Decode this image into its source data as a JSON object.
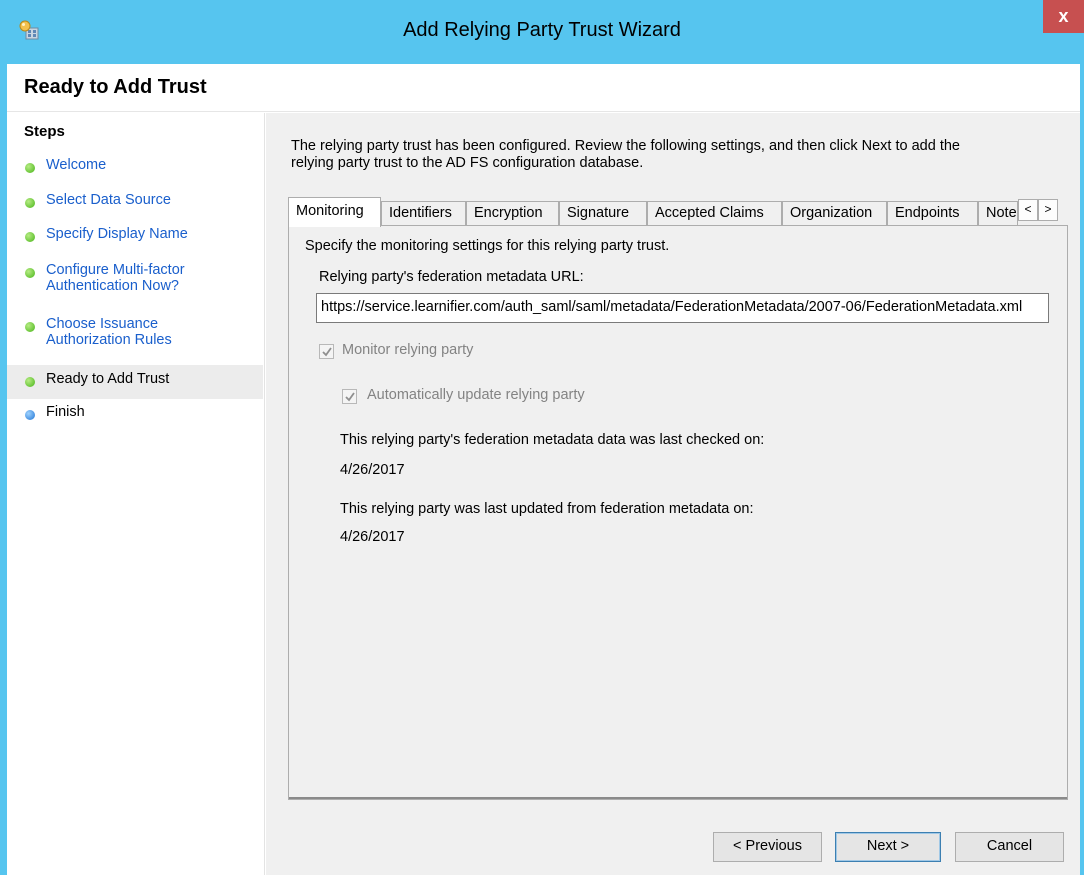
{
  "window": {
    "title": "Add Relying Party Trust Wizard",
    "close_glyph": "x"
  },
  "header": {
    "page_title": "Ready to Add Trust"
  },
  "steps": {
    "heading": "Steps",
    "items": [
      {
        "line1": "Welcome",
        "line2": "",
        "state": "done"
      },
      {
        "line1": "Select Data Source",
        "line2": "",
        "state": "done"
      },
      {
        "line1": "Specify Display Name",
        "line2": "",
        "state": "done"
      },
      {
        "line1": "Configure Multi-factor",
        "line2": "Authentication Now?",
        "state": "done"
      },
      {
        "line1": "Choose Issuance",
        "line2": "Authorization Rules",
        "state": "done"
      },
      {
        "line1": "Ready to Add Trust",
        "line2": "",
        "state": "current"
      },
      {
        "line1": "Finish",
        "line2": "",
        "state": "pending"
      }
    ]
  },
  "intro": {
    "line1": "The relying party trust has been configured. Review the following settings, and then click Next to add the",
    "line2": "relying party trust to the AD FS configuration database."
  },
  "tabs": {
    "items": [
      "Monitoring",
      "Identifiers",
      "Encryption",
      "Signature",
      "Accepted Claims",
      "Organization",
      "Endpoints",
      "Note"
    ],
    "selected": "Monitoring",
    "scroll_left": "<",
    "scroll_right": ">"
  },
  "monitoring": {
    "description": "Specify the monitoring settings for this relying party trust.",
    "url_label": "Relying party's federation metadata URL:",
    "url_value": "https://service.learnifier.com/auth_saml/saml/metadata/FederationMetadata/2007-06/FederationMetadata.xml",
    "monitor_label": "Monitor relying party",
    "monitor_checked": true,
    "auto_update_label": "Automatically update relying party",
    "auto_update_checked": true,
    "last_checked_label": "This relying party's federation metadata data was last checked on:",
    "last_checked_value": "4/26/2017",
    "last_updated_label": "This relying party was last updated from federation metadata on:",
    "last_updated_value": "4/26/2017"
  },
  "buttons": {
    "previous": "< Previous",
    "next": "Next >",
    "cancel": "Cancel"
  },
  "colors": {
    "titlebar": "#56c5ef",
    "close": "#c75050",
    "step_link": "#1a5fcc",
    "step_done": "#48b418",
    "step_pending": "#1f74d4"
  },
  "icons": {
    "app": "adfs-wizard-icon",
    "step_done": "green-dot-icon",
    "step_pending": "blue-dot-icon",
    "checkbox": "checkmark-icon"
  }
}
